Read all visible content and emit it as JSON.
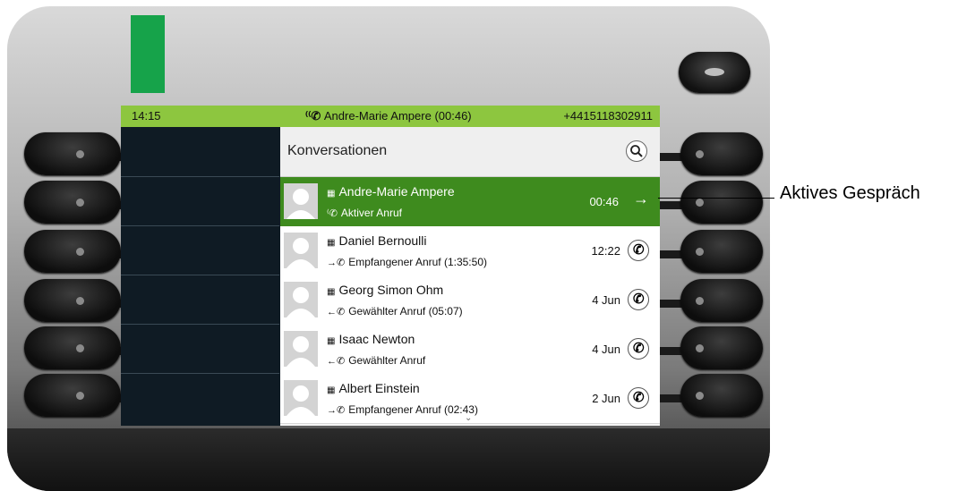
{
  "status_bar": {
    "time": "14:15",
    "active_call": "Andre-Marie Ampere (00:46)",
    "number": "+4415118302911"
  },
  "panel": {
    "title": "Konversationen"
  },
  "conversations": [
    {
      "name": "Andre-Marie Ampere",
      "status": "Aktiver Anruf",
      "time": "00:46",
      "active": true
    },
    {
      "name": "Daniel Bernoulli",
      "status": "Empfangener Anruf (1:35:50)",
      "time": "12:22",
      "active": false
    },
    {
      "name": "Georg Simon Ohm",
      "status": "Gewählter Anruf (05:07)",
      "time": "4 Jun",
      "active": false
    },
    {
      "name": "Isaac Newton",
      "status": "Gewählter Anruf",
      "time": "4 Jun",
      "active": false
    },
    {
      "name": "Albert Einstein",
      "status": "Empfangener Anruf (02:43)",
      "time": "2 Jun",
      "active": false
    }
  ],
  "callout": {
    "label": "Aktives Gespräch"
  },
  "icons": {
    "search": "search-icon",
    "building": "building-icon",
    "phone": "phone-icon",
    "arrow": "arrow-right-icon"
  },
  "colors": {
    "status_bar": "#8dc63f",
    "active_row": "#3e8b1e",
    "led": "#16a34a"
  }
}
